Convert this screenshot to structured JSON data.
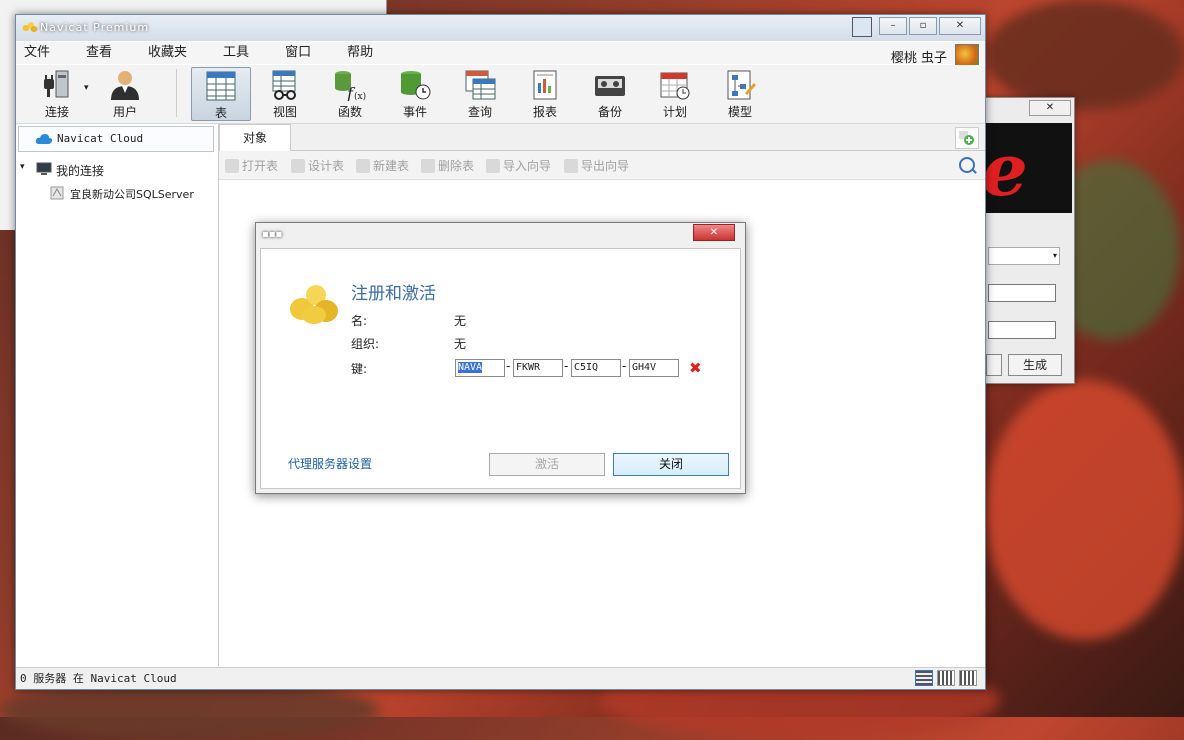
{
  "window": {
    "title": "Navicat Premium"
  },
  "menu": [
    "文件",
    "查看",
    "收藏夹",
    "工具",
    "窗口",
    "帮助"
  ],
  "user": {
    "name": "樱桃 虫子"
  },
  "toolbar": {
    "connect": "连接",
    "user": "用户",
    "table": "表",
    "view": "视图",
    "function": "函数",
    "event": "事件",
    "query": "查询",
    "report": "报表",
    "backup": "备份",
    "schedule": "计划",
    "model": "模型"
  },
  "sidebar": {
    "cloud": "Navicat Cloud",
    "my_connections": "我的连接",
    "connection": "宜良新动公司SQLServer"
  },
  "tabs": {
    "objects": "对象"
  },
  "object_toolbar": [
    "打开表",
    "设计表",
    "新建表",
    "删除表",
    "导入向导",
    "导出向导"
  ],
  "status": {
    "text": "0 服务器 在 Navicat Cloud"
  },
  "dialog": {
    "heading": "注册和激活",
    "name_label": "名:",
    "name_value": "无",
    "org_label": "组织:",
    "org_value": "无",
    "key_label": "键:",
    "keys": [
      "NAVA",
      "FKWR",
      "C5IQ",
      "GH4V"
    ],
    "proxy_link": "代理服务器设置",
    "activate": "激活",
    "close": "关闭"
  },
  "keygen": {
    "generate": "生成"
  },
  "colors": {
    "accent": "#3a6ea5",
    "error": "#e02020"
  }
}
